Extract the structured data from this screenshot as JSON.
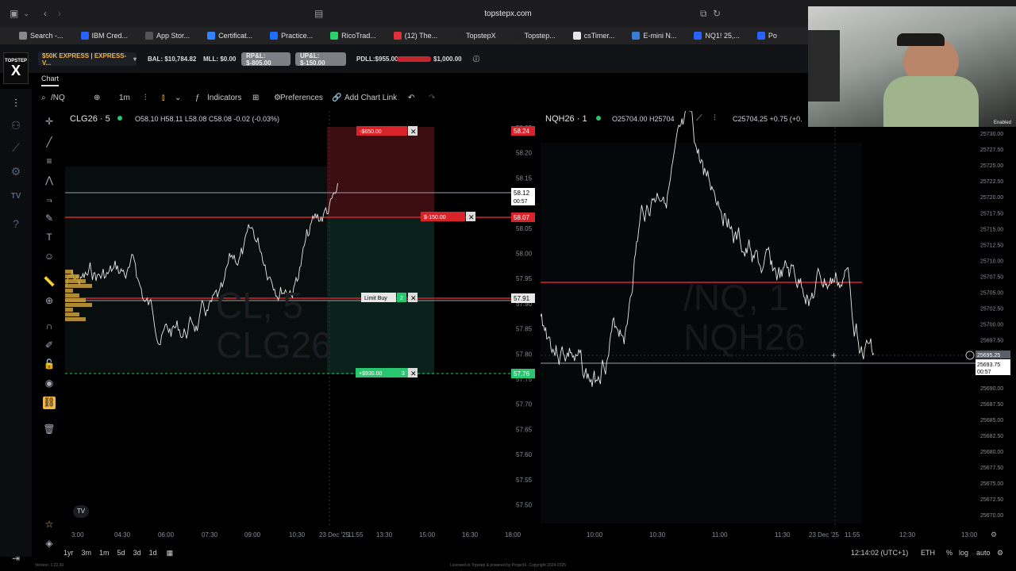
{
  "browser": {
    "url": "topstepx.com",
    "bookmarks": [
      {
        "label": "Search -...",
        "color": "#888888"
      },
      {
        "label": "IBM Cred...",
        "color": "#2962ff"
      },
      {
        "label": "App Stor...",
        "color": "#555555"
      },
      {
        "label": "Certificat...",
        "color": "#2e86ff"
      },
      {
        "label": "Practice...",
        "color": "#1e6fff"
      },
      {
        "label": "RicoTrad...",
        "color": "#2bd16b"
      },
      {
        "label": "(12) The...",
        "color": "#e0303a"
      },
      {
        "label": "TopstepX",
        "color": "#222222"
      },
      {
        "label": "Topstep...",
        "color": "#222222"
      },
      {
        "label": "csTimer...",
        "color": "#e6e6e6"
      },
      {
        "label": "E-mini N...",
        "color": "#3a7bd5"
      },
      {
        "label": "NQ1! 25,...",
        "color": "#2962ff"
      },
      {
        "label": "Po",
        "color": "#2962ff"
      }
    ]
  },
  "topbar": {
    "account": "$50K EXPRESS | EXPRESS-V...",
    "bal": "BAL: $10,784.82",
    "mll": "MLL: $0.00",
    "rpl": "RP&L: $-805.00",
    "upl": "UP&L: $-150.00",
    "pdll": "PDLL:$955.00",
    "dll_limit": "$1,000.00"
  },
  "tabs": {
    "chart": "Chart"
  },
  "toolbar": {
    "symbol": "/NQ",
    "interval": "1m",
    "indicators": "Indicators",
    "preferences": "Preferences",
    "add_chart_link": "Add Chart Link"
  },
  "left_chart": {
    "symbol": "CLG26 · 5",
    "ohlc": "O58.10 H58.11 L58.08 C58.08 -0.02 (-0.03%)",
    "watermark1": "CL, 5",
    "watermark2": "CLG26",
    "price_ticks": [
      "58.25",
      "58.20",
      "58.15",
      "58.10",
      "58.05",
      "58.00",
      "57.95",
      "57.90",
      "57.85",
      "57.80",
      "57.75",
      "57.70",
      "57.65",
      "57.60",
      "57.55",
      "57.50"
    ],
    "time_ticks": [
      "3:00",
      "04:30",
      "06:00",
      "07:30",
      "09:00",
      "10:30",
      "23 Dec '25",
      "11:55",
      "13:30",
      "15:00",
      "16:30",
      "18:00"
    ],
    "current_price": "58.12",
    "countdown": "00:57",
    "stop_tag": "58.24",
    "entry_tag": "58.07",
    "limit_tag": "57.91",
    "target_tag": "57.76",
    "stop_order_label": "-$650.00",
    "pnl_label": "$-150.00",
    "limit_label": "Limit Buy",
    "limit_qty": "2",
    "target_label": "+$930.00",
    "target_qty": "3"
  },
  "right_chart": {
    "symbol": "NQH26 · 1",
    "ohlc_left": "O25704.00 H25704",
    "ohlc_right": "C25704.25 +0.75 (+0.",
    "watermark1": "/NQ, 1",
    "watermark2": "NQH26",
    "price_ticks": [
      "25730.00",
      "25727.50",
      "25725.00",
      "25722.50",
      "25720.00",
      "25717.50",
      "25715.00",
      "25712.50",
      "25710.00",
      "25707.50",
      "25705.00",
      "25702.50",
      "25700.00",
      "25697.50",
      "25695.00",
      "25692.50",
      "25690.00",
      "25687.50",
      "25685.00",
      "25682.50",
      "25680.00",
      "25677.50",
      "25675.00",
      "25672.50",
      "25670.00"
    ],
    "time_ticks": [
      "10:00",
      "10:30",
      "11:00",
      "11:30",
      "23 Dec '25",
      "11:55",
      "12:30",
      "13:00"
    ],
    "cursor_price": "25695.25",
    "current_price": "25693.75",
    "countdown": "00:57"
  },
  "bottom": {
    "ranges": [
      "1yr",
      "3m",
      "1m",
      "5d",
      "3d",
      "1d"
    ],
    "clock": "12:14:02 (UTC+1)",
    "session": "ETH",
    "pct": "%",
    "log": "log",
    "auto": "auto"
  },
  "footer": "Licensed to Topstep & powered by ProjectX. Copyright 2024-2025",
  "version": "Version: 1.22.30",
  "webcam": {
    "badge": "Enabled"
  }
}
